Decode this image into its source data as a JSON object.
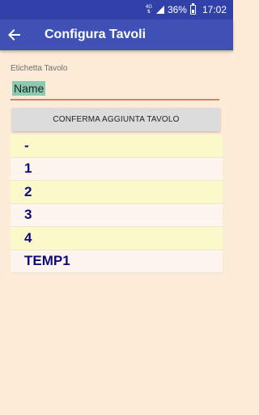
{
  "status_bar": {
    "network": "4G",
    "battery": "36%",
    "time": "17:02"
  },
  "toolbar": {
    "back_icon": "arrow-back-icon",
    "title": "Configura Tavoli"
  },
  "form": {
    "label": "Etichetta Tavolo",
    "placeholder": "Name",
    "confirm_label": "CONFERMA AGGIUNTA TAVOLO"
  },
  "tables": [
    {
      "label": "-"
    },
    {
      "label": "1"
    },
    {
      "label": "2"
    },
    {
      "label": "3"
    },
    {
      "label": "4"
    },
    {
      "label": "TEMP1"
    }
  ],
  "colors": {
    "toolbar": "#3F51B5",
    "status_bar": "#3042A9",
    "background": "#FBEBD7",
    "row_odd": "#FBF8C9",
    "row_even": "#FEF6EE",
    "row_text": "#0D0A7C",
    "input_underline": "#E57373"
  }
}
